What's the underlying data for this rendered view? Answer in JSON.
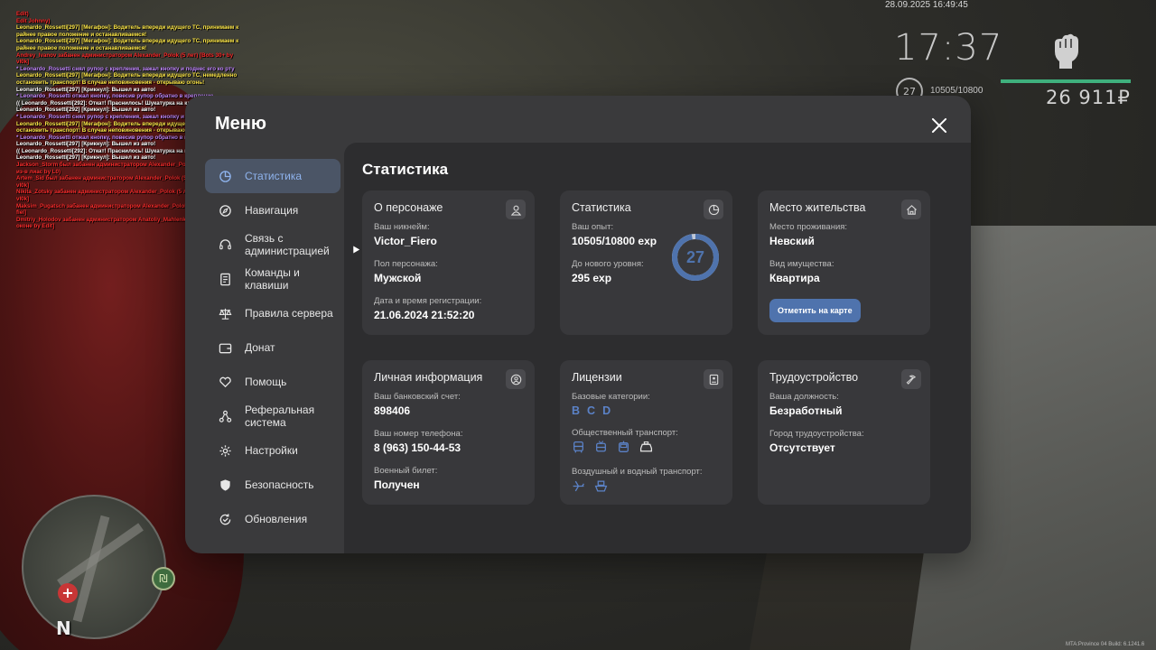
{
  "chat": [
    {
      "text": "Edit)",
      "color": "#ff2d2d"
    },
    {
      "text": "Edit Johnny)",
      "color": "#ff2d2d"
    },
    {
      "text": "Leonardo_Rossetti[297] [Мегафон]: Водитель впереди идущего ТС, принимаем к райнее правое положение и останавливаемся!",
      "color": "#ffe94a"
    },
    {
      "text": "Leonardo_Rossetti[297] [Мегафон]: Водитель впереди идущего ТС, принимаем к райнее правое положение и останавливаемся!",
      "color": "#ffe94a"
    },
    {
      "text": "Andrey_Ivanov забанен администратором Alexander_Polok (5 лет) [Bots 30+ by vl0k]",
      "color": "#ff2d2d"
    },
    {
      "text": "* Leonardo_Rossetti снял рупор с крепления, зажал кнопку и поднес его ко рту",
      "color": "#c48bff"
    },
    {
      "text": "Leonardo_Rossetti[297] [Мегафон]: Водитель впереди идущего ТС, немедленно остановить транспорт! В случае неповиновения - открываю огонь!",
      "color": "#ffe94a"
    },
    {
      "text": "Leonardo_Rossetti[297] [Крикнул]: Вышел из авто!",
      "color": "#ffffff"
    },
    {
      "text": "* Leonardo_Rossetti отжал кнопку, повесив рупор обратно в крепление",
      "color": "#c48bff"
    },
    {
      "text": "(( Leonardo_Rossetti[292]: Откат! Праснилось! Шукатурка на клаву упала! ))",
      "color": "#ffffff"
    },
    {
      "text": "Leonardo_Rossetti[292] [Крикнул]: Вышел из авто!",
      "color": "#ffffff"
    },
    {
      "text": "* Leonardo_Rossetti снял рупор с крепления, зажал кнопку и поднес его ко рту",
      "color": "#c48bff"
    },
    {
      "text": "Leonardo_Rossetti[297] [Мегафон]: Водитель впереди идущего ТС, немедленно остановить транспорт! В случае неповиновения - открываю огонь!",
      "color": "#ffe94a"
    },
    {
      "text": "* Leonardo_Rossetti отжал кнопку, повесив рупор обратно в крепление",
      "color": "#c48bff"
    },
    {
      "text": "Leonardo_Rossetti[297] [Крикнул]: Вышел из авто!",
      "color": "#ffffff"
    },
    {
      "text": "(( Leonardo_Rossetti[292]: Откат! Праснилось! Шукатурка на клаву упала! ))",
      "color": "#ffffff"
    },
    {
      "text": "Leonardo_Rossetti[297] [Крикнул]: Вышел из авто!",
      "color": "#ffffff"
    },
    {
      "text": "Jackson_Storm был забанен администратором Alexander_Polok (10 лет) (Муры из-в лиас by L0)",
      "color": "#ff2d2d"
    },
    {
      "text": "Artem_Sid был забанен администратором Alexander_Polok (5 лет) [Bots 30+ by vl0k]",
      "color": "#ff2d2d"
    },
    {
      "text": "Nikita_Zotsky забанен администратором Alexander_Polok (5 лет) [Maxs 30+ by vl0k]",
      "color": "#ff2d2d"
    },
    {
      "text": "Maksim_Pugatsch забанен администратором Alexander_Polok (5 лет) [Bots 30+ fiel]",
      "color": "#ff2d2d"
    },
    {
      "text": "Dmitriy_Holodov забанен администратором Anatoliy_Mahlenko (3 лет) [ЕНП при в оконе by Edit]",
      "color": "#ff2d2d"
    }
  ],
  "hud": {
    "date": "28.09.2025 16:49:45",
    "time": "17:37",
    "level": "27",
    "exp": "10505/10800",
    "money": "26 911₽",
    "build": "MTA:Province 04 Build: 6.1241.6"
  },
  "minimap": {
    "north": "N",
    "hospital": "+",
    "bank": "₪"
  },
  "menu": {
    "title": "Меню",
    "nav": [
      {
        "label": "Статистика",
        "icon": "pie-chart-icon"
      },
      {
        "label": "Навигация",
        "icon": "compass-icon"
      },
      {
        "label": "Связь с\nадминистрацией",
        "icon": "headset-icon"
      },
      {
        "label": "Команды и\nклавиши",
        "icon": "document-icon"
      },
      {
        "label": "Правила сервера",
        "icon": "scales-icon"
      },
      {
        "label": "Донат",
        "icon": "wallet-icon"
      },
      {
        "label": "Помощь",
        "icon": "heart-hand-icon"
      },
      {
        "label": "Реферальная\nсистема",
        "icon": "network-icon"
      },
      {
        "label": "Настройки",
        "icon": "gear-icon"
      },
      {
        "label": "Безопасность",
        "icon": "shield-icon"
      },
      {
        "label": "Обновления",
        "icon": "refresh-check-icon"
      }
    ],
    "active_index": 0
  },
  "stats": {
    "title": "Статистика",
    "persona": {
      "title": "О персонаже",
      "nick_label": "Ваш никнейм:",
      "nick": "Victor_Fiero",
      "gender_label": "Пол персонажа:",
      "gender": "Мужской",
      "reg_label": "Дата и время регистрации:",
      "reg": "21.06.2024 21:52:20"
    },
    "stat": {
      "title": "Статистика",
      "exp_label": "Ваш опыт:",
      "exp": "10505/10800 exp",
      "next_label": "До нового уровня:",
      "next": "295 exp",
      "level": "27",
      "progress": 0.9727
    },
    "residence": {
      "title": "Место жительства",
      "place_label": "Место проживания:",
      "place": "Невский",
      "type_label": "Вид имущества:",
      "type": "Квартира",
      "button": "Отметить на карте"
    },
    "personal": {
      "title": "Личная информация",
      "bank_label": "Ваш банковский счет:",
      "bank": "898406",
      "phone_label": "Ваш номер телефона:",
      "phone": "8 (963) 150-44-53",
      "military_label": "Военный билет:",
      "military": "Получен"
    },
    "licenses": {
      "title": "Лицензии",
      "base_label": "Базовые категории:",
      "categories": [
        "B",
        "C",
        "D"
      ],
      "public_label": "Общественный транспорт:",
      "public_icons": [
        "bus-icon",
        "trolleybus-icon",
        "tram-icon",
        "taxi-icon"
      ],
      "air_label": "Воздушный и водный транспорт:",
      "air_icons": [
        "airplane-icon",
        "ship-icon"
      ]
    },
    "job": {
      "title": "Трудоустройство",
      "position_label": "Ваша должность:",
      "position": "Безработный",
      "city_label": "Город трудоустройства:",
      "city": "Отсутствует"
    }
  },
  "colors": {
    "accent": "#4f73ad",
    "active_nav_text": "#8fb4ee",
    "panel": "#3a3a3c",
    "content": "#2d2d2f",
    "card": "#38383b",
    "hud_bar": "#3fb07d"
  }
}
